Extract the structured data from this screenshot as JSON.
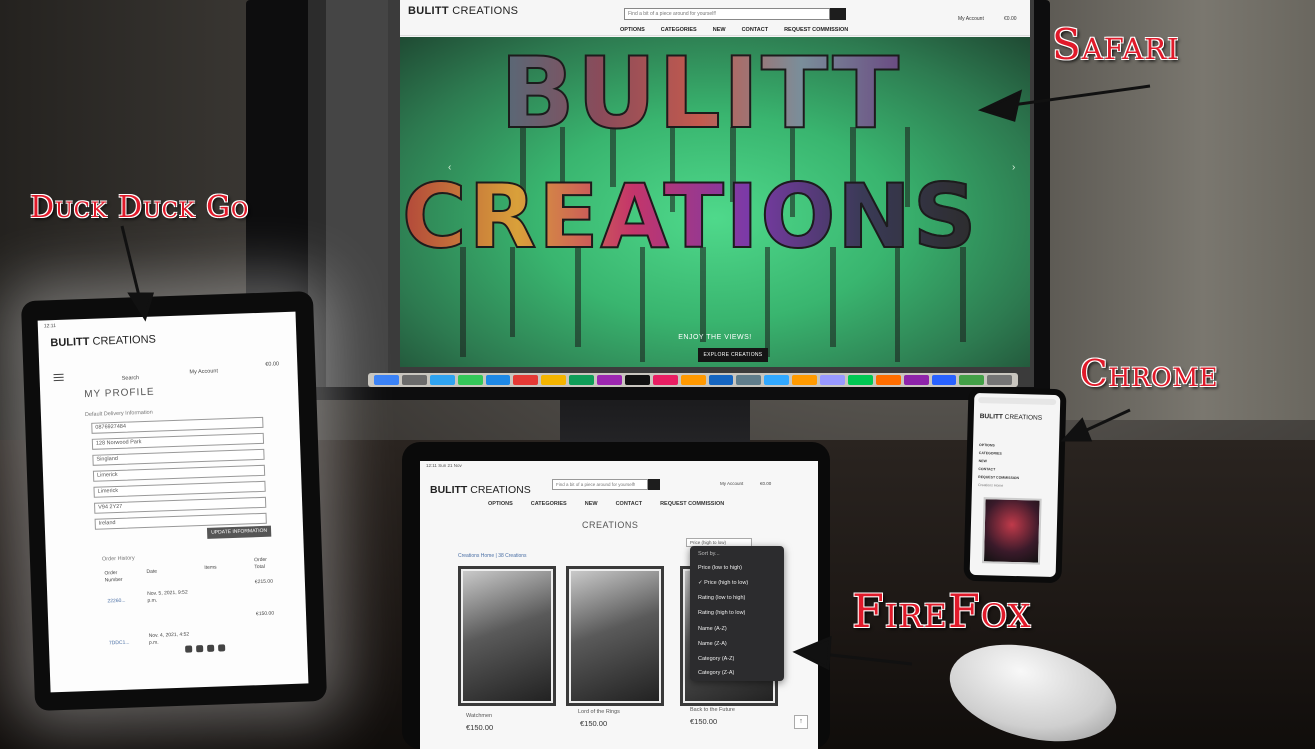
{
  "annotations": {
    "safari": "Safari",
    "duckduckgo": "Duck Duck Go",
    "chrome": "Chrome",
    "firefox": "FireFox"
  },
  "brand": {
    "bold": "BULITT",
    "light": " CREATIONS"
  },
  "safari_site": {
    "search_placeholder": "Find a bit of a piece around for yourself!",
    "account_label": "My Account",
    "cart_total": "€0.00",
    "nav": [
      "OPTIONS",
      "CATEGORIES",
      "NEW",
      "CONTACT",
      "REQUEST COMMISSION"
    ],
    "hero_line1": "BULITT",
    "hero_line2": "CREATIONS",
    "tagline": "ENJOY THE VIEWS!",
    "cta": "EXPLORE CREATIONS"
  },
  "ddg_site": {
    "status_time": "12:11",
    "search_label": "Search",
    "account_label": "My Account",
    "cart_total": "€0.00",
    "title": "MY PROFILE",
    "section": "Default Delivery Information",
    "fields": [
      "0876927484",
      "128 Norwood Park",
      "Singland",
      "Limerick",
      "Limerick",
      "V94 2Y27",
      "Ireland"
    ],
    "update_button": "UPDATE INFORMATION",
    "order_history": "Order History",
    "col_order": "Order Number",
    "col_date": "Date",
    "col_items": "Items",
    "col_total": "Order Total",
    "row1_num": "22260...",
    "row1_date": "Nov. 5, 2021, 9:52 p.m.",
    "row1_total": "€215.00",
    "row2_num": "7DDC1...",
    "row2_date": "Nov. 4, 2021, 4:52 p.m.",
    "row2_total": "€150.00"
  },
  "firefox_site": {
    "status_time": "12:11",
    "status_date": "Sun 21 Nov",
    "search_placeholder": "Find a bit of a piece around for yourself!",
    "account_label": "My Account",
    "cart_total": "€0.00",
    "nav": [
      "OPTIONS",
      "CATEGORIES",
      "NEW",
      "CONTACT",
      "REQUEST COMMISSION"
    ],
    "heading": "CREATIONS",
    "breadcrumb": "Creations Home | 38 Creations",
    "sort_value": "Price (high to low)",
    "sort_options": [
      "Sort by...",
      "Price (low to high)",
      "✓ Price (high to low)",
      "Rating (low to high)",
      "Rating (high to low)",
      "Name (A-Z)",
      "Name (Z-A)",
      "Category (A-Z)",
      "Category (Z-A)"
    ],
    "products": [
      {
        "title": "Watchmen",
        "price": "€150.00"
      },
      {
        "title": "Lord of the Rings",
        "price": "€150.00"
      },
      {
        "title": "Back to the Future",
        "price": "€150.00"
      }
    ],
    "scroll_top": "↑"
  },
  "chrome_site": {
    "menu": [
      "OPTIONS",
      "CATEGORIES",
      "NEW",
      "CONTACT",
      "REQUEST COMMISSION"
    ],
    "subtext": "Creations Home"
  }
}
